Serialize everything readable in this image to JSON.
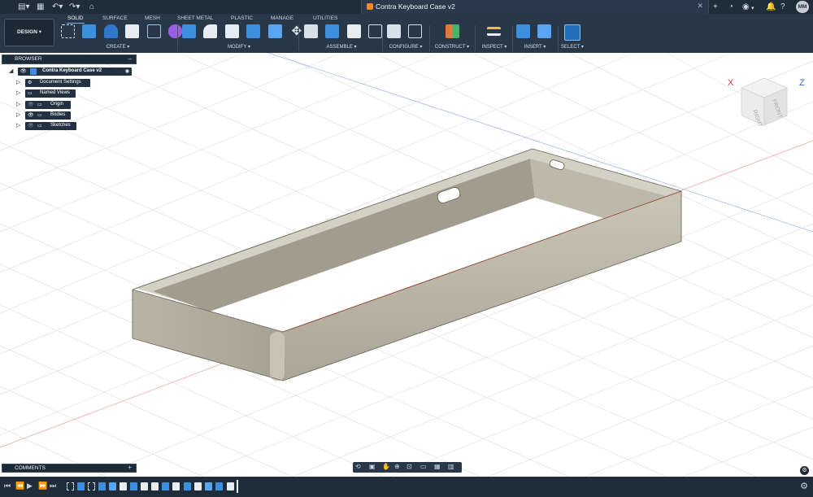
{
  "titlebar": {
    "document_title": "Contra Keyboard Case v2",
    "avatar_initials": "MM"
  },
  "ribbon": {
    "tabs": [
      "SOLID",
      "SURFACE",
      "MESH",
      "SHEET METAL",
      "PLASTIC",
      "MANAGE",
      "UTILITIES"
    ],
    "active_tab": "SOLID",
    "workspace": "DESIGN ▾",
    "groups": [
      {
        "label": "CREATE ▾"
      },
      {
        "label": "MODIFY ▾"
      },
      {
        "label": "ASSEMBLE ▾"
      },
      {
        "label": "CONFIGURE ▾"
      },
      {
        "label": "CONSTRUCT ▾"
      },
      {
        "label": "INSPECT ▾"
      },
      {
        "label": "INSERT ▾"
      },
      {
        "label": "SELECT ▾"
      }
    ]
  },
  "browser": {
    "title": "BROWSER",
    "collapse": "–",
    "root": "Contra Keyboard Case v2",
    "items": [
      {
        "label": "Document Settings"
      },
      {
        "label": "Named Views"
      },
      {
        "label": "Origin"
      },
      {
        "label": "Bodies"
      },
      {
        "label": "Sketches"
      }
    ]
  },
  "comments": {
    "title": "COMMENTS",
    "add": "+"
  },
  "viewcube": {
    "face_front": "FRONT",
    "face_right": "RIGHT",
    "axis_x": "X",
    "axis_z": "Z"
  },
  "colors": {
    "body_fill": "#b8b4a6",
    "grid": "#e7e7e7",
    "axis_red": "#d63b3b",
    "axis_blue": "#3a66cf",
    "ribbon_bg": "#283848"
  }
}
